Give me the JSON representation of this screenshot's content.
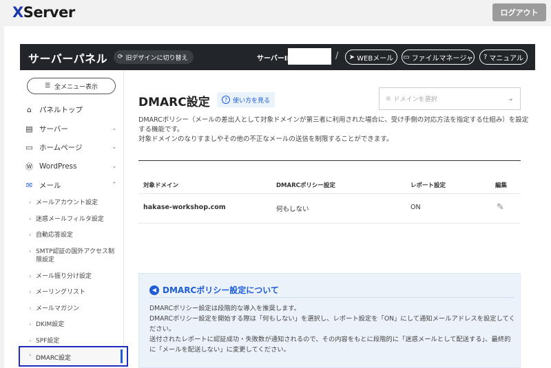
{
  "app": {
    "logo_x": "X",
    "logo_rest": "Server",
    "logout": "ログアウト"
  },
  "header": {
    "title": "サーバーパネル",
    "old_design": "旧デザインに切り替え",
    "server_id_label": "サーバーID",
    "slash": "/",
    "webmail": "WEBメール",
    "file_manager": "ファイルマネージャ",
    "manual": "マニュアル"
  },
  "sidebar": {
    "all_menu": "全メニュー表示",
    "items": [
      {
        "label": "パネルトップ",
        "icon": "home-icon"
      },
      {
        "label": "サーバー",
        "icon": "server-icon"
      },
      {
        "label": "ホームページ",
        "icon": "browser-icon"
      },
      {
        "label": "WordPress",
        "icon": "wordpress-icon"
      },
      {
        "label": "メール",
        "icon": "mail-icon"
      }
    ],
    "mail_sub": [
      "メールアカウント設定",
      "迷惑メールフィルタ設定",
      "自動応答設定",
      "SMTP認証の国外アクセス制限設定",
      "メール振り分け設定",
      "メーリングリスト",
      "メールマガジン",
      "DKIM設定",
      "SPF設定",
      "DMARC設定"
    ]
  },
  "main": {
    "page_title": "DMARC設定",
    "howto": "使い方を見る",
    "domain_placeholder": "ドメインを選択",
    "desc1": "DMARCポリシー（メールの差出人として対象ドメインが第三者に利用された場合に、受け手側の対応方法を指定する仕組み）を設定する機能です。",
    "desc2": "対象ドメインのなりすましやその他の不正なメールの送信を制限することができます。",
    "table": {
      "headers": [
        "対象ドメイン",
        "DMARCポリシー設定",
        "レポート設定",
        "編集"
      ],
      "rows": [
        {
          "domain": "hakase-workshop.com",
          "policy": "何もしない",
          "report": "ON"
        }
      ]
    },
    "info": {
      "title": "DMARCポリシー設定について",
      "l1": "DMARCポリシー設定は段階的な導入を推奨します。",
      "l2": "DMARCポリシー設定を開始する際は「何もしない」を選択し、レポート設定を「ON」にして通知メールアドレスを設定してください。",
      "l3": "送付されたレポートに認証成功・失敗数が通知されるので、その内容をもとに段階的に「迷惑メールとして配送する」、最終的に「メールを配送しない」に変更してください。"
    }
  }
}
